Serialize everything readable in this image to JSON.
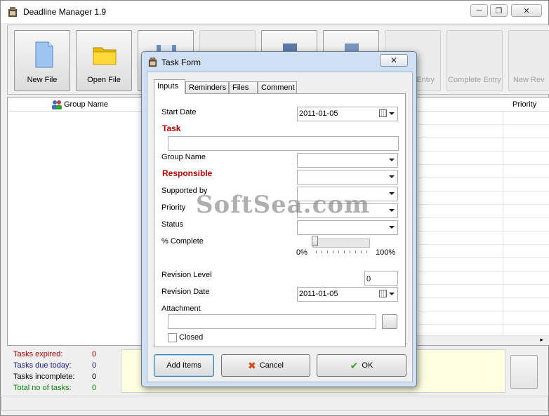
{
  "window": {
    "title": "Deadline Manager 1.9"
  },
  "toolbar": {
    "new_file": "New File",
    "open_file": "Open File",
    "entry_partial": "Entry",
    "complete_entry": "Complete Entry",
    "new_rev_partial": "New Rev"
  },
  "grid": {
    "col_group_name": "Group Name",
    "col_priority": "Priority"
  },
  "stats": {
    "expired_label": "Tasks expired:",
    "expired_value": "0",
    "due_today_label": "Tasks due today:",
    "due_today_value": "0",
    "incomplete_label": "Tasks incomplete:",
    "incomplete_value": "0",
    "total_label": "Total no of tasks:",
    "total_value": "0"
  },
  "dialog": {
    "title": "Task Form",
    "tabs": [
      "Inputs",
      "Reminders",
      "Files",
      "Comment"
    ],
    "fields": {
      "start_date_label": "Start Date",
      "start_date_value": "2011-01-05",
      "task_label": "Task",
      "task_value": "",
      "group_name_label": "Group Name",
      "responsible_label": "Responsible",
      "supported_by_label": "Supported by",
      "priority_label": "Priority",
      "status_label": "Status",
      "percent_complete_label": "% Complete",
      "percent_complete_value": 0,
      "slider_min": "0%",
      "slider_max": "100%",
      "revision_level_label": "Revision Level",
      "revision_level_value": "0",
      "revision_date_label": "Revision Date",
      "revision_date_value": "2011-01-05",
      "attachment_label": "Attachment",
      "closed_label": "Closed"
    },
    "buttons": {
      "add_items": "Add Items",
      "cancel": "Cancel",
      "ok": "OK"
    }
  },
  "watermark": "SoftSea.com",
  "colors": {
    "required": "#c00000",
    "expired": "#c00000",
    "due_today": "#1a1aa0",
    "total": "#0a8a0a",
    "notes_bg": "#ffffe1"
  }
}
